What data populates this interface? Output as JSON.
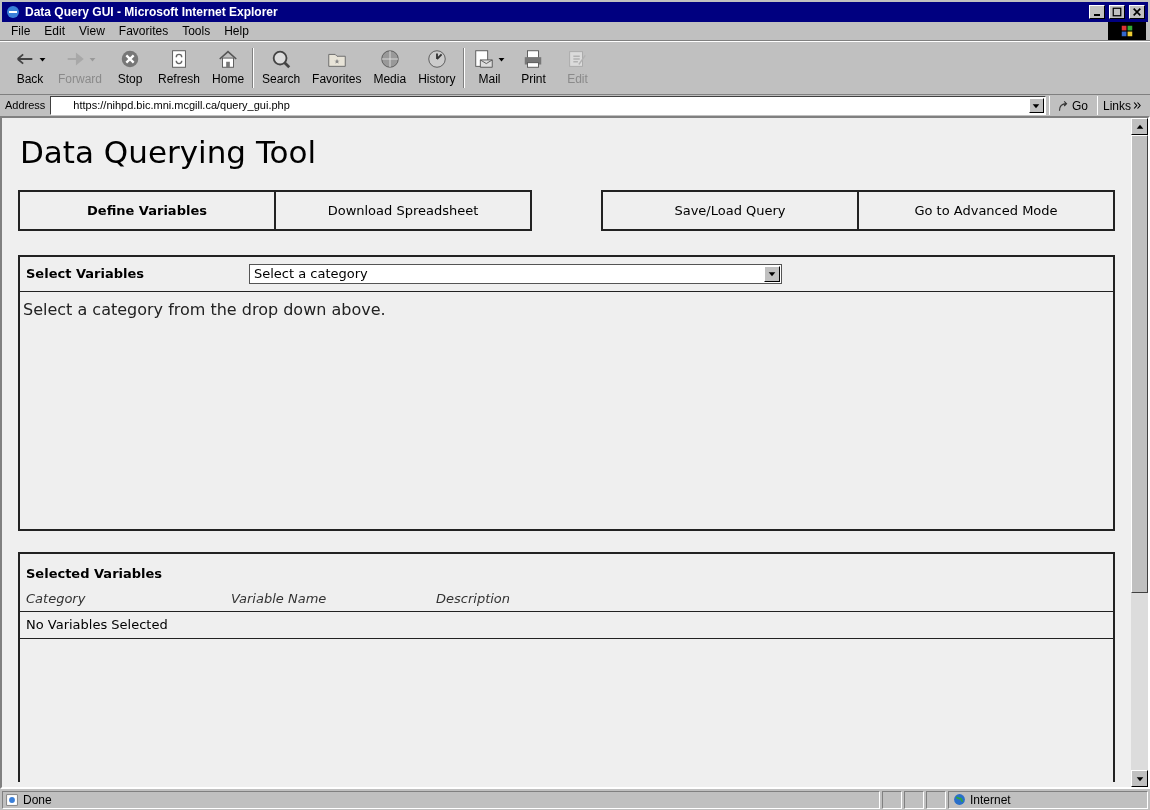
{
  "window": {
    "title": "Data Query GUI - Microsoft Internet Explorer"
  },
  "menu": [
    "File",
    "Edit",
    "View",
    "Favorites",
    "Tools",
    "Help"
  ],
  "toolbar": [
    {
      "label": "Back",
      "disabled": false,
      "dropdown": true
    },
    {
      "label": "Forward",
      "disabled": true,
      "dropdown": true
    },
    {
      "label": "Stop",
      "disabled": false,
      "dropdown": false
    },
    {
      "label": "Refresh",
      "disabled": false,
      "dropdown": false
    },
    {
      "label": "Home",
      "disabled": false,
      "dropdown": false
    },
    {
      "label": "Search",
      "disabled": false,
      "dropdown": false
    },
    {
      "label": "Favorites",
      "disabled": false,
      "dropdown": false
    },
    {
      "label": "Media",
      "disabled": false,
      "dropdown": false
    },
    {
      "label": "History",
      "disabled": false,
      "dropdown": false
    },
    {
      "label": "Mail",
      "disabled": false,
      "dropdown": true
    },
    {
      "label": "Print",
      "disabled": false,
      "dropdown": false
    },
    {
      "label": "Edit",
      "disabled": true,
      "dropdown": false
    }
  ],
  "address": {
    "label": "Address",
    "url": "https://nihpd.bic.mni.mcgill.ca/query_gui.php",
    "go": "Go",
    "links": "Links"
  },
  "page": {
    "heading": "Data Querying Tool",
    "nav_left": [
      {
        "label": "Define Variables",
        "selected": true
      },
      {
        "label": "Download Spreadsheet",
        "selected": false
      }
    ],
    "nav_right": [
      {
        "label": "Save/Load Query",
        "selected": false
      },
      {
        "label": "Go to Advanced Mode",
        "selected": false
      }
    ],
    "select_panel": {
      "title": "Select Variables",
      "dropdown": "Select a category",
      "message": "Select a category from the drop down above."
    },
    "selected_panel": {
      "title": "Selected Variables",
      "columns": [
        "Category",
        "Variable Name",
        "Description"
      ],
      "empty": "No Variables Selected"
    }
  },
  "status_bar": {
    "text": "Done",
    "zone": "Internet"
  }
}
